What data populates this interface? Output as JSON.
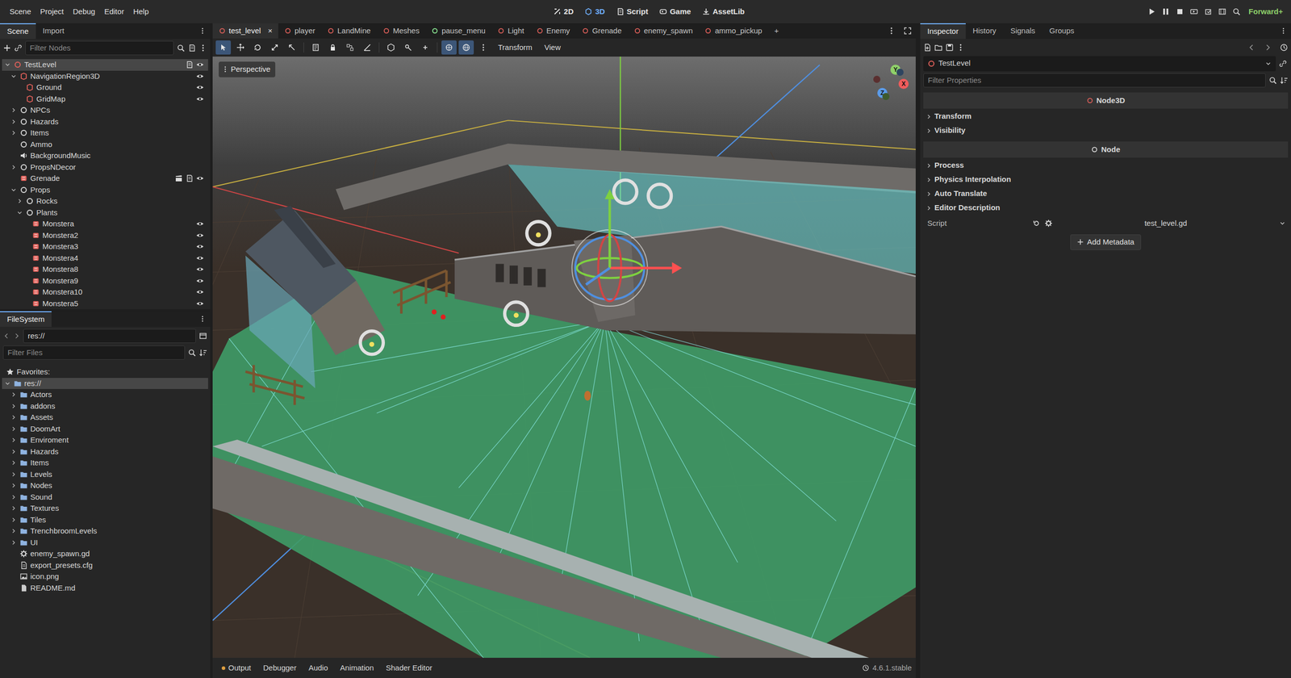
{
  "menu": [
    "Scene",
    "Project",
    "Debug",
    "Editor",
    "Help"
  ],
  "workspaces": [
    {
      "label": "2D",
      "selected": false
    },
    {
      "label": "3D",
      "selected": true
    },
    {
      "label": "Script",
      "selected": false
    },
    {
      "label": "Game",
      "selected": false
    },
    {
      "label": "AssetLib",
      "selected": false
    }
  ],
  "renderer": "Forward+",
  "scene_dock": {
    "tabs": [
      {
        "label": "Scene",
        "selected": true
      },
      {
        "label": "Import",
        "selected": false
      }
    ],
    "filter_placeholder": "Filter Nodes",
    "tree": [
      {
        "name": "TestLevel",
        "depth": 0,
        "has_children": true,
        "expanded": true,
        "selected": true,
        "kind": "ring",
        "color": "#e0605a",
        "instanced": false,
        "script": true,
        "eye": true
      },
      {
        "name": "NavigationRegion3D",
        "depth": 1,
        "has_children": true,
        "expanded": true,
        "selected": false,
        "kind": "mesh",
        "color": "#e0605a",
        "instanced": false,
        "script": false,
        "eye": true
      },
      {
        "name": "Ground",
        "depth": 2,
        "has_children": false,
        "expanded": false,
        "selected": false,
        "kind": "mesh",
        "color": "#e0605a",
        "instanced": false,
        "script": false,
        "eye": true
      },
      {
        "name": "GridMap",
        "depth": 2,
        "has_children": false,
        "expanded": false,
        "selected": false,
        "kind": "mesh",
        "color": "#e0605a",
        "instanced": false,
        "script": false,
        "eye": true
      },
      {
        "name": "NPCs",
        "depth": 1,
        "has_children": true,
        "expanded": false,
        "selected": false,
        "kind": "ring",
        "color": "#d8d8d8",
        "instanced": false,
        "script": false,
        "eye": false
      },
      {
        "name": "Hazards",
        "depth": 1,
        "has_children": true,
        "expanded": false,
        "selected": false,
        "kind": "ring",
        "color": "#d8d8d8",
        "instanced": false,
        "script": false,
        "eye": false
      },
      {
        "name": "Items",
        "depth": 1,
        "has_children": true,
        "expanded": false,
        "selected": false,
        "kind": "ring",
        "color": "#d8d8d8",
        "instanced": false,
        "script": false,
        "eye": false
      },
      {
        "name": "Ammo",
        "depth": 1,
        "has_children": false,
        "expanded": false,
        "selected": false,
        "kind": "ring",
        "color": "#d8d8d8",
        "instanced": false,
        "script": false,
        "eye": false
      },
      {
        "name": "BackgroundMusic",
        "depth": 1,
        "has_children": false,
        "expanded": false,
        "selected": false,
        "kind": "audio",
        "color": "#d8d8d8",
        "instanced": false,
        "script": false,
        "eye": false
      },
      {
        "name": "PropsNDecor",
        "depth": 1,
        "has_children": true,
        "expanded": false,
        "selected": false,
        "kind": "ring",
        "color": "#d8d8d8",
        "instanced": false,
        "script": false,
        "eye": false
      },
      {
        "name": "Grenade",
        "depth": 1,
        "has_children": false,
        "expanded": false,
        "selected": false,
        "kind": "instance",
        "color": "#e0605a",
        "instanced": true,
        "script": true,
        "eye": true
      },
      {
        "name": "Props",
        "depth": 1,
        "has_children": true,
        "expanded": true,
        "selected": false,
        "kind": "ring",
        "color": "#d8d8d8",
        "instanced": false,
        "script": false,
        "eye": false
      },
      {
        "name": "Rocks",
        "depth": 2,
        "has_children": true,
        "expanded": false,
        "selected": false,
        "kind": "ring",
        "color": "#d8d8d8",
        "instanced": false,
        "script": false,
        "eye": false
      },
      {
        "name": "Plants",
        "depth": 2,
        "has_children": true,
        "expanded": true,
        "selected": false,
        "kind": "ring",
        "color": "#d8d8d8",
        "instanced": false,
        "script": false,
        "eye": false
      },
      {
        "name": "Monstera",
        "depth": 3,
        "has_children": false,
        "expanded": false,
        "selected": false,
        "kind": "instance",
        "color": "#e0605a",
        "instanced": false,
        "script": false,
        "eye": true
      },
      {
        "name": "Monstera2",
        "depth": 3,
        "has_children": false,
        "expanded": false,
        "selected": false,
        "kind": "instance",
        "color": "#e0605a",
        "instanced": false,
        "script": false,
        "eye": true
      },
      {
        "name": "Monstera3",
        "depth": 3,
        "has_children": false,
        "expanded": false,
        "selected": false,
        "kind": "instance",
        "color": "#e0605a",
        "instanced": false,
        "script": false,
        "eye": true
      },
      {
        "name": "Monstera4",
        "depth": 3,
        "has_children": false,
        "expanded": false,
        "selected": false,
        "kind": "instance",
        "color": "#e0605a",
        "instanced": false,
        "script": false,
        "eye": true
      },
      {
        "name": "Monstera8",
        "depth": 3,
        "has_children": false,
        "expanded": false,
        "selected": false,
        "kind": "instance",
        "color": "#e0605a",
        "instanced": false,
        "script": false,
        "eye": true
      },
      {
        "name": "Monstera9",
        "depth": 3,
        "has_children": false,
        "expanded": false,
        "selected": false,
        "kind": "instance",
        "color": "#e0605a",
        "instanced": false,
        "script": false,
        "eye": true
      },
      {
        "name": "Monstera10",
        "depth": 3,
        "has_children": false,
        "expanded": false,
        "selected": false,
        "kind": "instance",
        "color": "#e0605a",
        "instanced": false,
        "script": false,
        "eye": true
      },
      {
        "name": "Monstera5",
        "depth": 3,
        "has_children": false,
        "expanded": false,
        "selected": false,
        "kind": "instance",
        "color": "#e0605a",
        "instanced": false,
        "script": false,
        "eye": true
      }
    ]
  },
  "filesystem": {
    "title": "FileSystem",
    "path": "res://",
    "filter_placeholder": "Filter Files",
    "favorites": "Favorites:",
    "items": [
      {
        "label": "res://",
        "depth": 0,
        "kind": "folder",
        "expanded": true,
        "selected": true
      },
      {
        "label": "Actors",
        "depth": 1,
        "kind": "folder",
        "expanded": false,
        "selected": false
      },
      {
        "label": "addons",
        "depth": 1,
        "kind": "folder",
        "expanded": false,
        "selected": false
      },
      {
        "label": "Assets",
        "depth": 1,
        "kind": "folder",
        "expanded": false,
        "selected": false
      },
      {
        "label": "DoomArt",
        "depth": 1,
        "kind": "folder",
        "expanded": false,
        "selected": false
      },
      {
        "label": "Enviroment",
        "depth": 1,
        "kind": "folder",
        "expanded": false,
        "selected": false
      },
      {
        "label": "Hazards",
        "depth": 1,
        "kind": "folder",
        "expanded": false,
        "selected": false
      },
      {
        "label": "Items",
        "depth": 1,
        "kind": "folder",
        "expanded": false,
        "selected": false
      },
      {
        "label": "Levels",
        "depth": 1,
        "kind": "folder",
        "expanded": false,
        "selected": false
      },
      {
        "label": "Nodes",
        "depth": 1,
        "kind": "folder",
        "expanded": false,
        "selected": false
      },
      {
        "label": "Sound",
        "depth": 1,
        "kind": "folder",
        "expanded": false,
        "selected": false
      },
      {
        "label": "Textures",
        "depth": 1,
        "kind": "folder",
        "expanded": false,
        "selected": false
      },
      {
        "label": "Tiles",
        "depth": 1,
        "kind": "folder",
        "expanded": false,
        "selected": false
      },
      {
        "label": "TrenchbroomLevels",
        "depth": 1,
        "kind": "folder",
        "expanded": false,
        "selected": false
      },
      {
        "label": "UI",
        "depth": 1,
        "kind": "folder",
        "expanded": false,
        "selected": false
      },
      {
        "label": "enemy_spawn.gd",
        "depth": 1,
        "kind": "script",
        "expanded": false,
        "selected": false
      },
      {
        "label": "export_presets.cfg",
        "depth": 1,
        "kind": "config",
        "expanded": false,
        "selected": false
      },
      {
        "label": "icon.png",
        "depth": 1,
        "kind": "image",
        "expanded": false,
        "selected": false
      },
      {
        "label": "README.md",
        "depth": 1,
        "kind": "text",
        "expanded": false,
        "selected": false
      }
    ]
  },
  "editor_tabs": [
    {
      "label": "test_level",
      "selected": true,
      "color": "#e0605a"
    },
    {
      "label": "player",
      "selected": false,
      "color": "#e0605a"
    },
    {
      "label": "LandMine",
      "selected": false,
      "color": "#e0605a"
    },
    {
      "label": "Meshes",
      "selected": false,
      "color": "#e0605a"
    },
    {
      "label": "pause_menu",
      "selected": false,
      "color": "#8eef97"
    },
    {
      "label": "Light",
      "selected": false,
      "color": "#e0605a"
    },
    {
      "label": "Enemy",
      "selected": false,
      "color": "#e0605a"
    },
    {
      "label": "Grenade",
      "selected": false,
      "color": "#e0605a"
    },
    {
      "label": "enemy_spawn",
      "selected": false,
      "color": "#e0605a"
    },
    {
      "label": "ammo_pickup",
      "selected": false,
      "color": "#e0605a"
    }
  ],
  "close_label": "×",
  "add_label": "+",
  "tools": [
    {
      "selected": true
    },
    {
      "selected": false
    },
    {
      "selected": false
    },
    {
      "selected": false
    },
    {
      "selected": false
    },
    {
      "selected": false
    },
    {
      "selected": false
    },
    {
      "selected": false
    },
    {
      "selected": false
    },
    {
      "selected": false
    },
    {
      "selected": false
    },
    {
      "selected": false
    },
    {
      "selected": true
    },
    {
      "selected": true
    }
  ],
  "viewport_menus": [
    "Transform",
    "View"
  ],
  "viewport": {
    "perspective": "Perspective",
    "gizmo": {
      "x": "X",
      "y": "Y",
      "z": "Z"
    }
  },
  "bottom_tabs": [
    "Output",
    "Debugger",
    "Audio",
    "Animation",
    "Shader Editor"
  ],
  "version": "4.6.1.stable",
  "inspector": {
    "tabs": [
      {
        "label": "Inspector",
        "selected": true
      },
      {
        "label": "History",
        "selected": false
      },
      {
        "label": "Signals",
        "selected": false
      },
      {
        "label": "Groups",
        "selected": false
      }
    ],
    "node": "TestLevel",
    "filter_placeholder": "Filter Properties",
    "classes": [
      {
        "label": "Node3D",
        "color": "#e0605a",
        "groups": [
          {
            "label": "Transform",
            "expanded": false
          },
          {
            "label": "Visibility",
            "expanded": false
          }
        ]
      },
      {
        "label": "Node",
        "color": "#d8d8d8",
        "groups": [
          {
            "label": "Process",
            "expanded": false
          },
          {
            "label": "Physics Interpolation",
            "expanded": false
          },
          {
            "label": "Auto Translate",
            "expanded": false
          },
          {
            "label": "Editor Description",
            "expanded": false
          }
        ]
      }
    ],
    "script": {
      "label": "Script",
      "value": "test_level.gd"
    },
    "add_metadata": "Add Metadata"
  }
}
